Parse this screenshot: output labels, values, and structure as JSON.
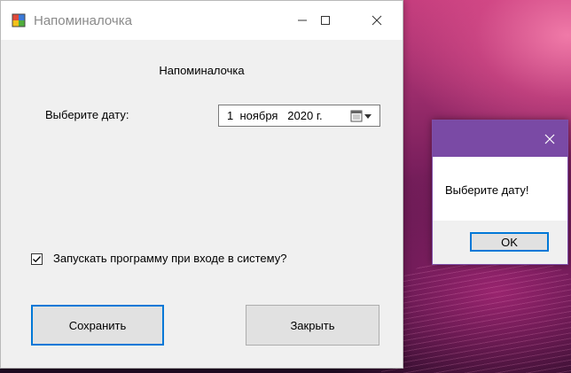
{
  "window": {
    "title": "Напоминалочка",
    "heading": "Напоминалочка",
    "date_label": "Выберите дату:",
    "date_value": "1  ноября   2020 г.",
    "autostart_label": "Запускать программу при входе в систему?",
    "autostart_checked": true,
    "save_label": "Сохранить",
    "close_label": "Закрыть"
  },
  "message_box": {
    "text": "Выберите дату!",
    "ok_label": "OK"
  },
  "colors": {
    "accent": "#0078d7",
    "msgbox_titlebar": "#7a4aa5"
  }
}
